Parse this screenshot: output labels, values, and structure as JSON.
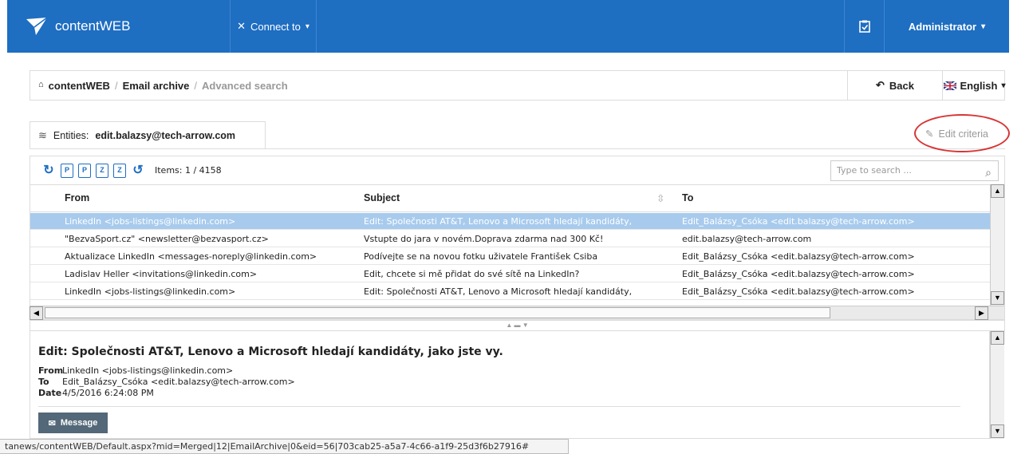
{
  "topbar": {
    "brand": "contentWEB",
    "connect_label": "Connect to",
    "user_label": "Administrator",
    "bg_color": "#1e6ec2"
  },
  "breadcrumb": {
    "home": "contentWEB",
    "section": "Email archive",
    "current": "Advanced search",
    "separator": "/"
  },
  "nav": {
    "back_label": "Back",
    "language_label": "English"
  },
  "entities": {
    "label": "Entities:",
    "value": "edit.balazsy@tech-arrow.com"
  },
  "edit_criteria_label": "Edit criteria",
  "toolbar": {
    "items_text": "Items: 1 / 4158",
    "search_placeholder": "Type to search ..."
  },
  "grid": {
    "columns": [
      "From",
      "Subject",
      "To"
    ],
    "rows": [
      {
        "from": "LinkedIn <jobs-listings@linkedin.com>",
        "subject": "Edit: Společnosti AT&T, Lenovo a Microsoft hledají kandidáty,",
        "to": "Edit_Balázsy_Csóka <edit.balazsy@tech-arrow.com>"
      },
      {
        "from": "\"BezvaSport.cz\" <newsletter@bezvasport.cz>",
        "subject": "Vstupte do jara v novém.Doprava zdarma nad 300 Kč!",
        "to": "edit.balazsy@tech-arrow.com"
      },
      {
        "from": "Aktualizace LinkedIn <messages-noreply@linkedin.com>",
        "subject": "Podívejte se na novou fotku uživatele František Csiba",
        "to": "Edit_Balázsy_Csóka <edit.balazsy@tech-arrow.com>"
      },
      {
        "from": "Ladislav Heller <invitations@linkedin.com>",
        "subject": "Edit, chcete si mě přidat do své sítě na LinkedIn?",
        "to": "Edit_Balázsy_Csóka <edit.balazsy@tech-arrow.com>"
      },
      {
        "from": "LinkedIn <jobs-listings@linkedin.com>",
        "subject": "Edit: Společnosti AT&T, Lenovo a Microsoft hledají kandidáty,",
        "to": "Edit_Balázsy_Csóka <edit.balazsy@tech-arrow.com>"
      }
    ]
  },
  "preview": {
    "title": "Edit: Společnosti AT&T, Lenovo a Microsoft hledají kandidáty, jako jste vy.",
    "from_label": "From",
    "from_value": "LinkedIn <jobs-listings@linkedin.com>",
    "to_label": "To",
    "to_value": "Edit_Balázsy_Csóka <edit.balazsy@tech-arrow.com>",
    "date_label": "Date",
    "date_value": "4/5/2016 6:24:08 PM",
    "message_tab": "Message"
  },
  "status_url": "tanews/contentWEB/Default.aspx?mid=Merged|12|EmailArchive|0&eid=56|703cab25-a5a7-4c66-a1f9-25d3f6b27916#"
}
